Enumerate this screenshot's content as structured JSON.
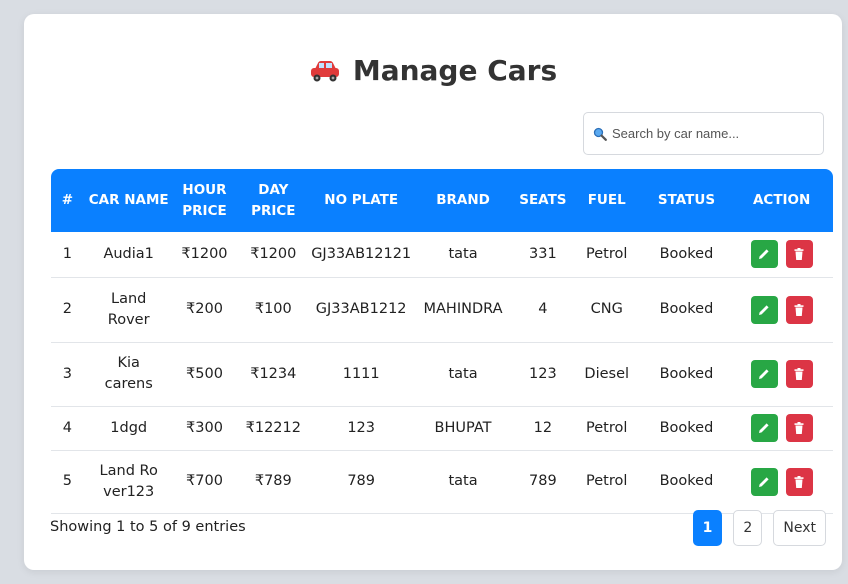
{
  "header": {
    "title": "Manage Cars",
    "title_icon": "car-icon"
  },
  "search": {
    "placeholder": "Search by car name...",
    "value": ""
  },
  "table": {
    "columns": [
      "#",
      "CAR NAME",
      "HOUR PRICE",
      "DAY PRICE",
      "NO PLATE",
      "BRAND",
      "SEATS",
      "FUEL",
      "STATUS",
      "ACTION"
    ],
    "rows": [
      {
        "num": "1",
        "car_name": "Audia1",
        "hour_price": "₹1200",
        "day_price": "₹1200",
        "no_plate": "GJ33AB12121",
        "brand": "tata",
        "seats": "331",
        "fuel": "Petrol",
        "status": "Booked"
      },
      {
        "num": "2",
        "car_name": "Land Rover",
        "hour_price": "₹200",
        "day_price": "₹100",
        "no_plate": "GJ33AB1212",
        "brand": "MAHINDRA",
        "seats": "4",
        "fuel": "CNG",
        "status": "Booked"
      },
      {
        "num": "3",
        "car_name": "Kia carens",
        "hour_price": "₹500",
        "day_price": "₹1234",
        "no_plate": "1111",
        "brand": "tata",
        "seats": "123",
        "fuel": "Diesel",
        "status": "Booked"
      },
      {
        "num": "4",
        "car_name": "1dgd",
        "hour_price": "₹300",
        "day_price": "₹12212",
        "no_plate": "123",
        "brand": "BHUPAT",
        "seats": "12",
        "fuel": "Petrol",
        "status": "Booked"
      },
      {
        "num": "5",
        "car_name": "Land Rover123",
        "hour_price": "₹700",
        "day_price": "₹789",
        "no_plate": "789",
        "brand": "tata",
        "seats": "789",
        "fuel": "Petrol",
        "status": "Booked"
      }
    ]
  },
  "footer": {
    "info": "Showing 1 to 5 of 9 entries"
  },
  "pagination": {
    "pages": [
      "1",
      "2"
    ],
    "active_page": "1",
    "next_label": "Next"
  },
  "colors": {
    "header_bg": "#0a80ff",
    "edit": "#28a745",
    "delete": "#dc3545",
    "page_bg": "#d9dde3"
  }
}
